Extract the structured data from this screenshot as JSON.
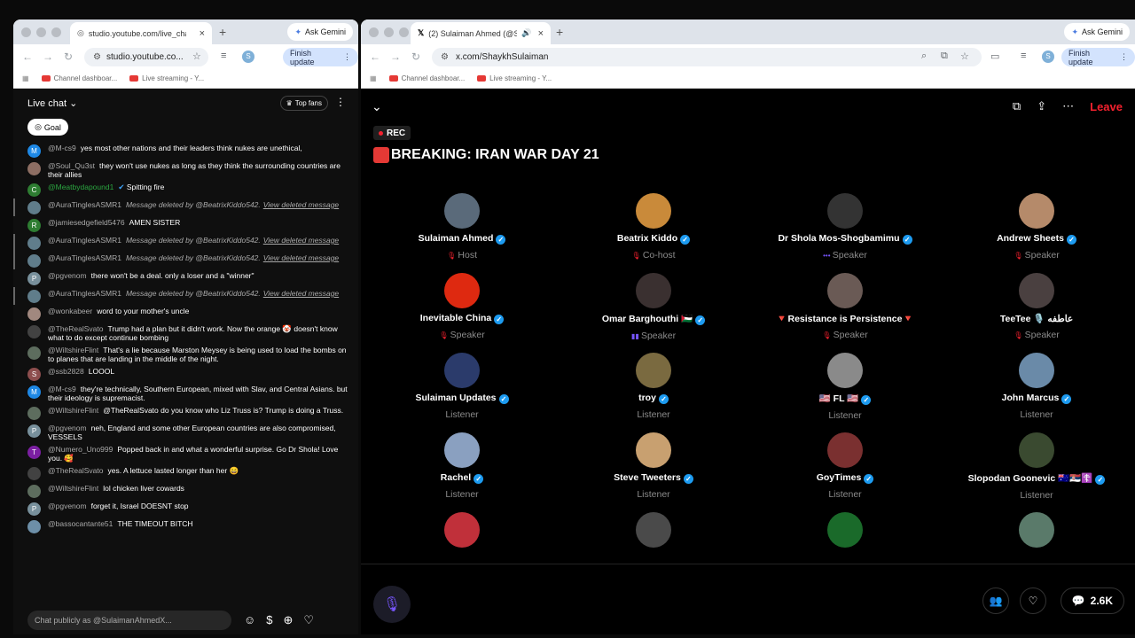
{
  "left_window": {
    "tab_title": "studio.youtube.com/live_chat",
    "url": "studio.youtube.co...",
    "ask_gemini": "Ask Gemini",
    "finish_update": "Finish update",
    "profile_initial": "S",
    "bookmarks": [
      "Channel dashboar...",
      "Live streaming - Y..."
    ],
    "chat": {
      "title": "Live chat",
      "top_fans": "Top fans",
      "goal": "Goal",
      "input_placeholder": "Chat publicly as @SulaimanAhmedX...",
      "messages": [
        {
          "user": "@M-cs9",
          "text": "yes most other nations and their leaders think nukes are unethical,",
          "avatar": "M",
          "color": "#1e88e5"
        },
        {
          "user": "@Soul_Qu3st",
          "text": "they won't use nukes as long as they think the surrounding countries are their allies",
          "avatar": "",
          "color": "#8d6e63"
        },
        {
          "user": "@Meatbydapound1",
          "text": "Spitting fire",
          "avatar": "C",
          "color": "#2e7d32",
          "green": true
        },
        {
          "user": "@AuraTinglesASMR1",
          "text": "Message deleted by @BeatrixKiddo542.",
          "link": "View deleted message",
          "deleted": true,
          "avatar": "",
          "color": "#607d8b"
        },
        {
          "user": "@jamiesedgefield5476",
          "text": "AMEN SISTER",
          "avatar": "R",
          "color": "#2e7d32"
        },
        {
          "user": "@AuraTinglesASMR1",
          "text": "Message deleted by @BeatrixKiddo542.",
          "link": "View deleted message",
          "deleted": true,
          "avatar": "",
          "color": "#607d8b"
        },
        {
          "user": "@AuraTinglesASMR1",
          "text": "Message deleted by @BeatrixKiddo542.",
          "link": "View deleted message",
          "deleted": true,
          "avatar": "",
          "color": "#607d8b"
        },
        {
          "user": "@pgvenom",
          "text": "there won't be a deal. only a loser and a \"winner\"",
          "avatar": "P",
          "color": "#78909c"
        },
        {
          "user": "@AuraTinglesASMR1",
          "text": "Message deleted by @BeatrixKiddo542.",
          "link": "View deleted message",
          "deleted": true,
          "avatar": "",
          "color": "#607d8b"
        },
        {
          "user": "@wonkabeer",
          "text": "word to your mother's uncle",
          "avatar": "",
          "color": "#a1887f"
        },
        {
          "user": "@TheRealSvato",
          "text": "Trump had a plan but it didn't work. Now the orange 🤡 doesn't know what to do except continue bombing",
          "avatar": "",
          "color": "#424242"
        },
        {
          "user": "@WiltshireFlint",
          "text": "That's a lie because Marston Meysey is being used to load the bombs on to planes that are landing in the middle of the night.",
          "avatar": "",
          "color": "#5d6d5e"
        },
        {
          "user": "@ssb2828",
          "text": "LOOOL",
          "avatar": "S",
          "color": "#8d4e4e"
        },
        {
          "user": "@M-cs9",
          "text": "they're technically, Southern European, mixed with Slav, and Central Asians. but their ideology is supremacist.",
          "avatar": "M",
          "color": "#1e88e5"
        },
        {
          "user": "@WiltshireFlint",
          "text": "@TheRealSvato do you know who Liz Truss is? Trump is doing a Truss.",
          "avatar": "",
          "color": "#5d6d5e"
        },
        {
          "user": "@pgvenom",
          "text": "neh, England and some other European countries are also compromised, VESSELS",
          "avatar": "P",
          "color": "#78909c"
        },
        {
          "user": "@Numero_Uno999",
          "text": "Popped back in and what a wonderful surprise. Go Dr Shola! Love you. 🥰",
          "avatar": "T",
          "color": "#7b1fa2"
        },
        {
          "user": "@TheRealSvato",
          "text": "yes. A lettuce lasted longer than her 😄",
          "avatar": "",
          "color": "#424242"
        },
        {
          "user": "@WiltshireFlint",
          "text": "lol chicken liver cowards",
          "avatar": "",
          "color": "#5d6d5e"
        },
        {
          "user": "@pgvenom",
          "text": "forget it, Israel DOESNT stop",
          "avatar": "P",
          "color": "#78909c"
        },
        {
          "user": "@bassocantante51",
          "text": "THE TIMEOUT BITCH",
          "avatar": "",
          "color": "#6d8fa8"
        }
      ]
    }
  },
  "right_window": {
    "tab_title": "(2) Sulaiman Ahmed (@Sh",
    "url": "x.com/ShaykhSulaiman",
    "ask_gemini": "Ask Gemini",
    "finish_update": "Finish update",
    "profile_initial": "S",
    "bookmarks": [
      "Channel dashboar...",
      "Live streaming - Y..."
    ],
    "space": {
      "rec": "REC",
      "title": "BREAKING: IRAN WAR DAY 21",
      "leave": "Leave",
      "listener_count": "2.6K",
      "participants": [
        {
          "name": "Sulaiman Ahmed",
          "role": "Host",
          "verified": true,
          "color": "#5a6a7a"
        },
        {
          "name": "Beatrix Kiddo",
          "role": "Co-host",
          "verified": true,
          "color": "#c98a3a"
        },
        {
          "name": "Dr Shola Mos-Shogbamimu",
          "role": "Speaker",
          "verified": true,
          "color": "#333333"
        },
        {
          "name": "Andrew Sheets",
          "role": "Speaker",
          "verified": true,
          "color": "#b58a6a"
        },
        {
          "name": "Inevitable China",
          "role": "Speaker",
          "verified": true,
          "color": "#de2910"
        },
        {
          "name": "Omar Barghouthi 🇵🇸",
          "role": "Speaker",
          "verified": true,
          "color": "#3a3030"
        },
        {
          "name": "🔻Resistance is Persistence🔻",
          "role": "Speaker",
          "verified": false,
          "color": "#6a5a55"
        },
        {
          "name": "TeeTee 🎙️ عاطفه",
          "role": "Speaker",
          "verified": false,
          "color": "#4a4040"
        },
        {
          "name": "Sulaiman Updates",
          "role": "Listener",
          "verified": true,
          "color": "#2b3b6b"
        },
        {
          "name": "troy",
          "role": "Listener",
          "verified": true,
          "color": "#7a6a40"
        },
        {
          "name": "🇺🇸 FL 🇺🇸",
          "role": "Listener",
          "verified": true,
          "color": "#8a8a8a"
        },
        {
          "name": "John Marcus",
          "role": "Listener",
          "verified": true,
          "color": "#6a8aa8"
        },
        {
          "name": "Rachel",
          "role": "Listener",
          "verified": true,
          "color": "#8aa0c0"
        },
        {
          "name": "Steve Tweeters",
          "role": "Listener",
          "verified": true,
          "color": "#c8a070"
        },
        {
          "name": "GoyTimes",
          "role": "Listener",
          "verified": true,
          "color": "#7a3030"
        },
        {
          "name": "Slopodan Goonevic 🇦🇺🇷🇸☦️",
          "role": "Listener",
          "verified": true,
          "color": "#3a4a30"
        },
        {
          "name": "",
          "role": "",
          "verified": false,
          "color": "#c0303a"
        },
        {
          "name": "",
          "role": "",
          "verified": false,
          "color": "#4a4a4a"
        },
        {
          "name": "",
          "role": "",
          "verified": false,
          "color": "#1a6a2a"
        },
        {
          "name": "",
          "role": "",
          "verified": false,
          "color": "#5a7a6a"
        }
      ]
    }
  }
}
